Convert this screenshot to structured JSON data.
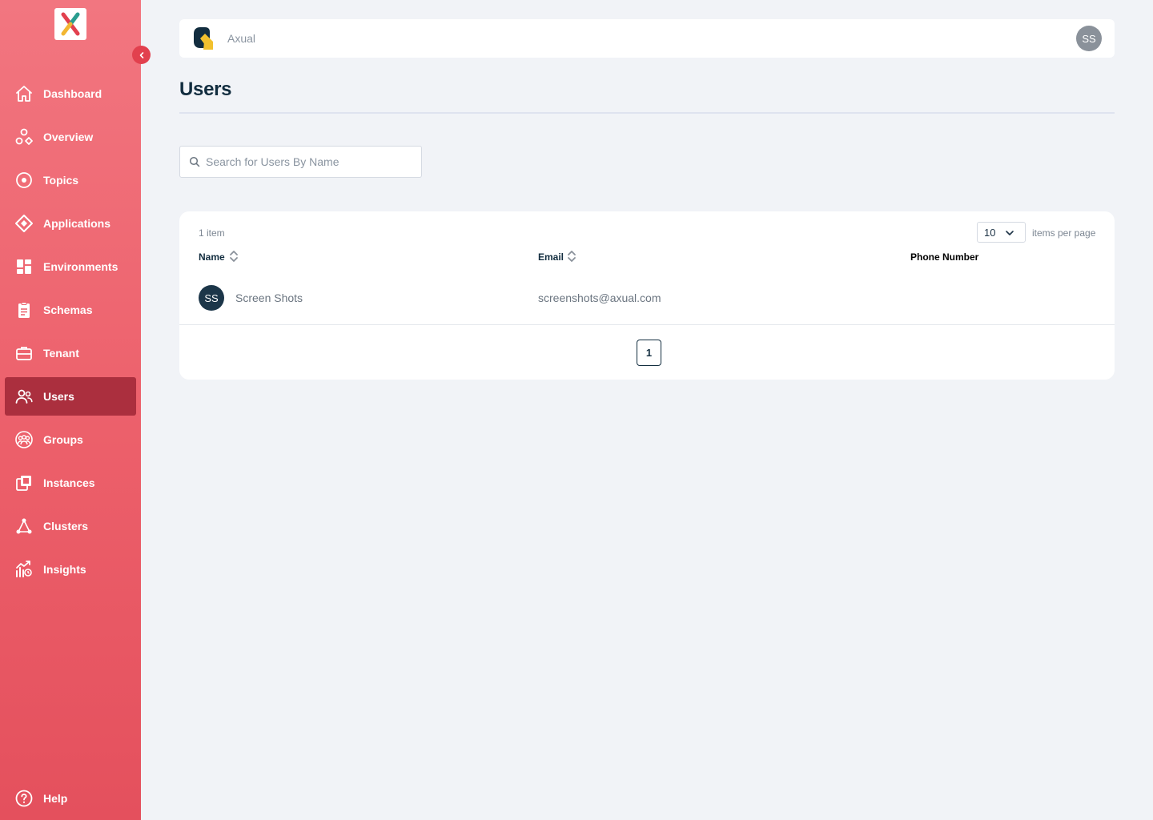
{
  "sidebar": {
    "collapse_icon": "chevron-left-icon",
    "items": [
      {
        "label": "Dashboard",
        "icon": "home-icon"
      },
      {
        "label": "Overview",
        "icon": "overview-shapes-icon"
      },
      {
        "label": "Topics",
        "icon": "topic-target-icon"
      },
      {
        "label": "Applications",
        "icon": "application-diamond-icon"
      },
      {
        "label": "Environments",
        "icon": "grid-icon"
      },
      {
        "label": "Schemas",
        "icon": "clipboard-icon"
      },
      {
        "label": "Tenant",
        "icon": "briefcase-icon"
      },
      {
        "label": "Users",
        "icon": "users-icon",
        "active": true
      },
      {
        "label": "Groups",
        "icon": "group-icon"
      },
      {
        "label": "Instances",
        "icon": "instances-icon"
      },
      {
        "label": "Clusters",
        "icon": "cluster-icon"
      },
      {
        "label": "Insights",
        "icon": "insights-chart-icon"
      }
    ],
    "help": {
      "label": "Help",
      "icon": "help-icon"
    }
  },
  "topbar": {
    "tenant_name": "Axual",
    "user_initials": "SS"
  },
  "page": {
    "title": "Users"
  },
  "search": {
    "placeholder": "Search for Users By Name",
    "value": ""
  },
  "table": {
    "item_count": "1 item",
    "per_page": "10",
    "per_page_label": "items per page",
    "columns": {
      "name": "Name",
      "email": "Email",
      "phone": "Phone Number"
    },
    "rows": [
      {
        "initials": "SS",
        "name": "Screen Shots",
        "email": "screenshots@axual.com",
        "phone": ""
      }
    ],
    "pagination": {
      "current_page": "1"
    }
  },
  "colors": {
    "sidebar_top": "#f27680",
    "sidebar_bottom": "#e4505d",
    "sidebar_active": "#ab2f3e",
    "navy": "#122d3f",
    "background": "#f1f3f7"
  }
}
